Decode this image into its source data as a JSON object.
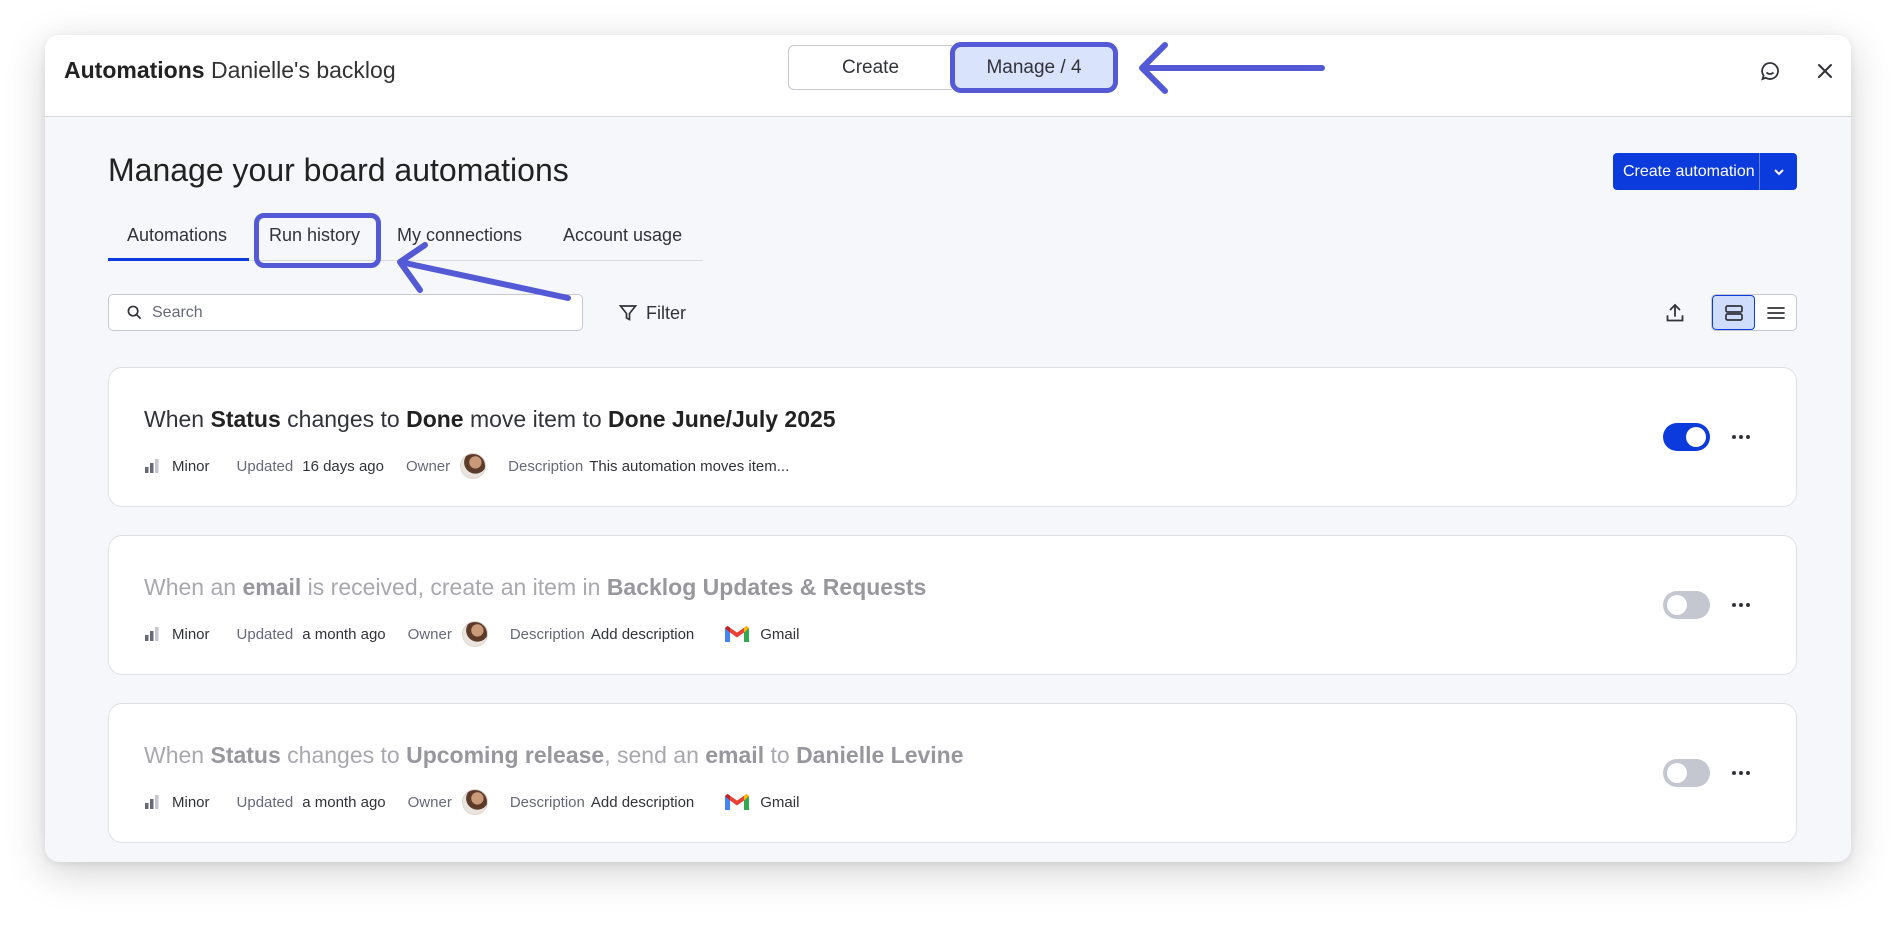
{
  "header": {
    "title_strong": "Automations",
    "board_name": "Danielle's backlog",
    "segments": {
      "create": "Create",
      "manage": "Manage / 4"
    }
  },
  "page": {
    "heading": "Manage your board automations",
    "create_button": "Create automation"
  },
  "tabs": [
    {
      "label": "Automations",
      "active": true
    },
    {
      "label": "Run history",
      "highlighted": true
    },
    {
      "label": "My connections"
    },
    {
      "label": "Account usage"
    }
  ],
  "toolbar": {
    "search_placeholder": "Search",
    "filter_label": "Filter"
  },
  "automations": [
    {
      "sentence": [
        {
          "t": "When ",
          "b": false
        },
        {
          "t": "Status",
          "b": true
        },
        {
          "t": " changes to ",
          "b": false
        },
        {
          "t": "Done",
          "b": true
        },
        {
          "t": " move item to ",
          "b": false
        },
        {
          "t": "Done June/July 2025",
          "b": true
        }
      ],
      "priority": "Minor",
      "updated_label": "Updated",
      "updated_value": "16 days ago",
      "owner_label": "Owner",
      "description_label": "Description",
      "description_value": "This automation moves item...",
      "integration": "",
      "enabled": true
    },
    {
      "sentence": [
        {
          "t": "When an ",
          "b": false
        },
        {
          "t": "email",
          "b": true
        },
        {
          "t": " is received, create an item in ",
          "b": false
        },
        {
          "t": "Backlog Updates & Requests",
          "b": true
        }
      ],
      "priority": "Minor",
      "updated_label": "Updated",
      "updated_value": "a month ago",
      "owner_label": "Owner",
      "description_label": "Description",
      "description_value": "Add description",
      "integration": "Gmail",
      "enabled": false
    },
    {
      "sentence": [
        {
          "t": "When ",
          "b": false
        },
        {
          "t": "Status",
          "b": true
        },
        {
          "t": " changes to ",
          "b": false
        },
        {
          "t": "Upcoming release",
          "b": true
        },
        {
          "t": ", send an ",
          "b": false
        },
        {
          "t": "email",
          "b": true
        },
        {
          "t": " to ",
          "b": false
        },
        {
          "t": "Danielle Levine",
          "b": true
        }
      ],
      "priority": "Minor",
      "updated_label": "Updated",
      "updated_value": "a month ago",
      "owner_label": "Owner",
      "description_label": "Description",
      "description_value": "Add description",
      "integration": "Gmail",
      "enabled": false
    }
  ],
  "colors": {
    "accent": "#0b3bdc",
    "annotation": "#5459d6",
    "selected_bg": "#d9e3fc"
  }
}
